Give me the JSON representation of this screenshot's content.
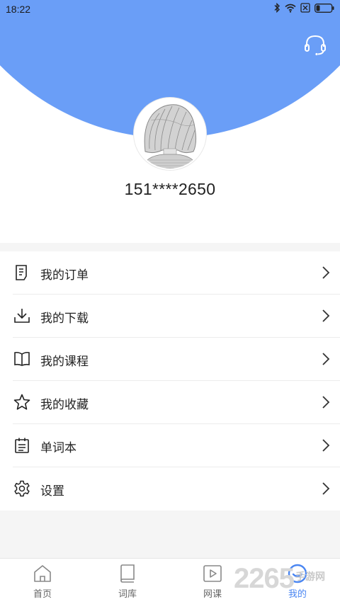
{
  "status_bar": {
    "time": "18:22"
  },
  "header": {
    "service_icon": "headset-icon"
  },
  "profile": {
    "phone": "151****2650"
  },
  "menu": [
    {
      "label": "我的订单",
      "icon": "order-icon"
    },
    {
      "label": "我的下载",
      "icon": "download-icon"
    },
    {
      "label": "我的课程",
      "icon": "book-open-icon"
    },
    {
      "label": "我的收藏",
      "icon": "star-icon"
    },
    {
      "label": "单词本",
      "icon": "notebook-icon"
    },
    {
      "label": "设置",
      "icon": "gear-icon"
    }
  ],
  "tabs": [
    {
      "label": "首页",
      "icon": "home-icon"
    },
    {
      "label": "词库",
      "icon": "book-icon"
    },
    {
      "label": "网课",
      "icon": "play-icon"
    },
    {
      "label": "我的",
      "icon": "profile-icon",
      "active": true
    }
  ],
  "watermark": {
    "number": "2265",
    "text": "手游网"
  },
  "colors": {
    "accent": "#6a9ef7",
    "active_tab": "#4a86f2"
  }
}
